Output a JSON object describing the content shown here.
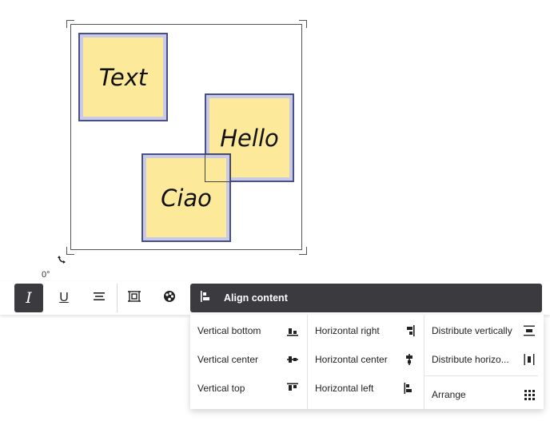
{
  "canvas": {
    "rotation_label": "0°",
    "notes": [
      {
        "text": "Text"
      },
      {
        "text": "Hello"
      },
      {
        "text": "Ciao"
      }
    ]
  },
  "toolbar": {
    "italic_label": "I",
    "underline_label": "U",
    "align_content_label": "Align content"
  },
  "dropdown": {
    "col1": [
      "Vertical bottom",
      "Vertical center",
      "Vertical top"
    ],
    "col2": [
      "Horizontal right",
      "Horizontal center",
      "Horizontal left"
    ],
    "col3": [
      "Distribute vertically",
      "Distribute horizo...",
      "Arrange"
    ]
  },
  "colors": {
    "note_fill": "#fce99a",
    "note_border": "#4a4f8a",
    "note_halo": "#c9cbe6",
    "toolbar_active": "#3b3b3f"
  }
}
